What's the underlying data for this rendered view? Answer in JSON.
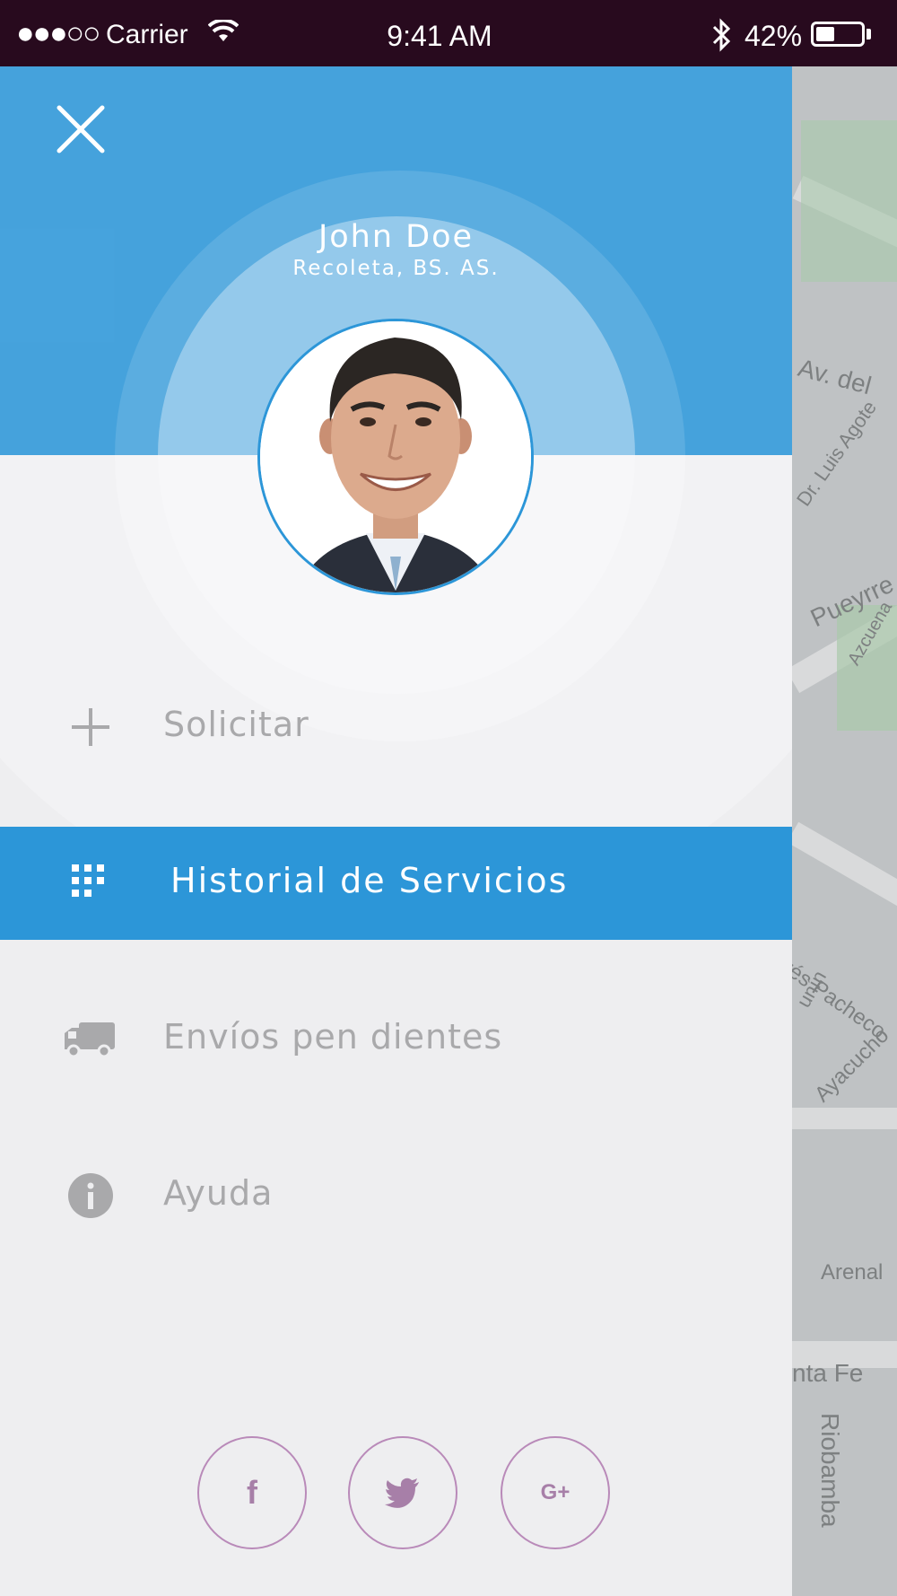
{
  "status_bar": {
    "signal": "●●●○○",
    "carrier": "Carrier",
    "time": "9:41 AM",
    "battery": "42%",
    "battery_level": 0.42
  },
  "user": {
    "name": "John Doe",
    "location": "Recoleta, BS. AS."
  },
  "menu": {
    "items": [
      {
        "label": "Solicitar",
        "icon": "plus-icon",
        "active": false
      },
      {
        "label": "Historial de Servicios",
        "icon": "grid-icon",
        "active": true
      },
      {
        "label": "Envíos pen dientes",
        "icon": "truck-icon",
        "active": false
      },
      {
        "label": "Ayuda",
        "icon": "info-icon",
        "active": false
      }
    ]
  },
  "social": {
    "facebook": "f",
    "twitter": "twitter-bird-icon",
    "google": "G+"
  },
  "map": {
    "streets": [
      "Av. del",
      "Dr. Luis Agote",
      "Pueyrre",
      "Azcuena",
      "rés Pacheco",
      "unín",
      "Ayacucho",
      "Arenal",
      "nta Fe",
      "Riobamba"
    ]
  },
  "colors": {
    "accent": "#2c96d8",
    "status_bar": "#280a1e",
    "social_border": "#b98ab9",
    "menu_text": "#a9a9ab"
  }
}
